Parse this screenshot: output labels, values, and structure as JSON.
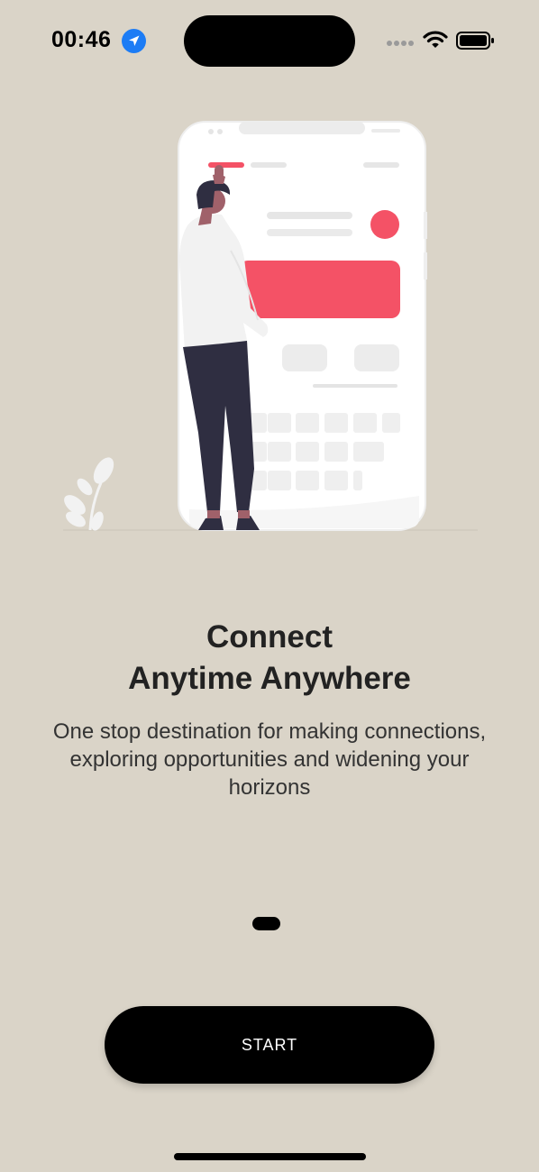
{
  "status_bar": {
    "time": "00:46",
    "icons": [
      "location-arrow-icon",
      "cellular-signal-icon",
      "wifi-icon",
      "battery-icon"
    ]
  },
  "onboarding": {
    "title_line1": "Connect",
    "title_line2": "Anytime Anywhere",
    "subtitle": "One stop destination for making connections, exploring opportunities and widening your horizons",
    "page_indicator": {
      "current": 1
    }
  },
  "actions": {
    "start_label": "START"
  },
  "colors": {
    "background": "#DAD4C8",
    "accent": "#F45266",
    "button": "#000000",
    "button_text": "#FFFFFF"
  }
}
